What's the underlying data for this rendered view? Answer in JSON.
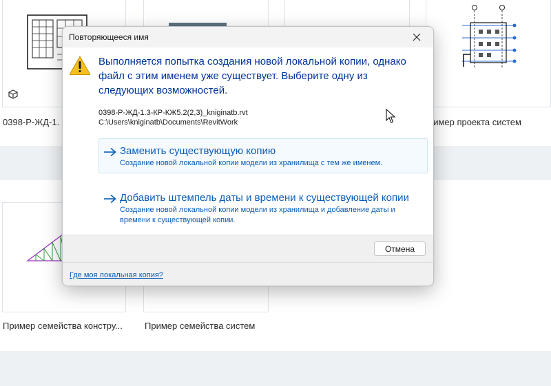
{
  "background": {
    "tiles_row1": [
      {
        "label": "0398-Р-ЖД-1."
      },
      {
        "label": ""
      },
      {
        "label": ""
      },
      {
        "label": "ример проекта систем"
      }
    ],
    "tiles_row2": [
      {
        "label": "Пример семейства констру..."
      },
      {
        "label": "Пример семейства систем"
      }
    ]
  },
  "dialog": {
    "title": "Повторяющееся имя",
    "close_icon": "close-icon",
    "warning_icon": "warning-icon",
    "main_instruction": "Выполняется попытка создания новой локальной копии, однако файл с этим именем уже существует. Выберите одну из следующих возможностей.",
    "file_name": "0398-Р-ЖД-1.3-КР-КЖ5.2(2,3)_kniginatb.rvt",
    "file_path": "C:\\Users\\kniginatb\\Documents\\RevitWork",
    "commands": [
      {
        "title": "Заменить существующую копию",
        "description": "Создание новой локальной копии модели из хранилища с тем же именем."
      },
      {
        "title": "Добавить штемпель даты и времени к существующей копии",
        "description": "Создание новой локальной копии модели из хранилища и добавление даты и времени к существующей копии."
      }
    ],
    "cancel_label": "Отмена",
    "footer_link": "Где моя локальная копия?",
    "accent_color": "#0a5cb6",
    "instruction_color": "#003399"
  }
}
